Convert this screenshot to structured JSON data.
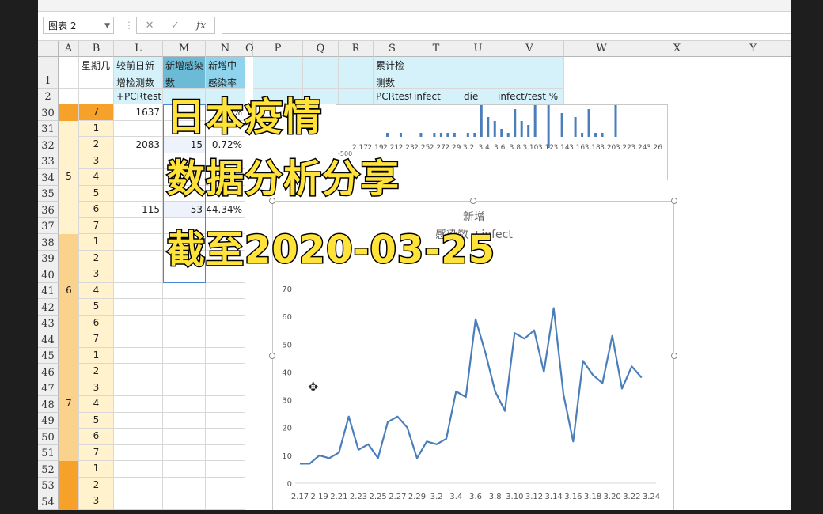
{
  "name_box": "图表 2",
  "formula_icons": {
    "cancel": "✕",
    "enter": "✓",
    "fx": "fx"
  },
  "columns": [
    "A",
    "B",
    "L",
    "M",
    "N",
    "O",
    "P",
    "Q",
    "R",
    "S",
    "T",
    "U",
    "V",
    "W",
    "X",
    "Y"
  ],
  "header_row1": {
    "B": "星期几",
    "L": "较前日新增检测数",
    "M": "新增感染数",
    "N": "新增中感染率",
    "S": "累计检测数"
  },
  "header_row2": {
    "L": "+PCRtest",
    "S": "PCRtest",
    "T": "infect",
    "U": "die",
    "V": "infect/test %"
  },
  "row_numbers": [
    "1",
    "2",
    "30",
    "31",
    "32",
    "33",
    "34",
    "35",
    "36",
    "37",
    "38",
    "39",
    "40",
    "41",
    "42",
    "43",
    "44",
    "45",
    "46",
    "47",
    "48",
    "49",
    "50",
    "51",
    "52",
    "53",
    "54"
  ],
  "weekdays": [
    "7",
    "1",
    "2",
    "3",
    "4",
    "5",
    "6",
    "7",
    "1",
    "2",
    "3",
    "4",
    "5",
    "6",
    "7",
    "1",
    "2",
    "3",
    "4",
    "5",
    "6",
    "7",
    "1",
    "2",
    "3"
  ],
  "week_labels": {
    "w5": "5",
    "w6": "6",
    "w7": "7"
  },
  "visible_values": {
    "L32": "2083",
    "M32": "15",
    "N32": "0.72%",
    "L36": "115",
    "M36": "53",
    "N36": "44.34%",
    "L30": "1637",
    "N30": "%"
  },
  "overlay": {
    "line1": "日本疫情",
    "line2": "数据分析分享",
    "line3": "截至2020-03-25"
  },
  "top_chart": {
    "ytick": "-500",
    "xlabels": [
      "2.17",
      "2.19",
      "2.21",
      "2.23",
      "2.25",
      "2.27",
      "2.29",
      "3.2",
      "3.4",
      "3.6",
      "3.8",
      "3.10",
      "3.12",
      "3.14",
      "3.16",
      "3.18",
      "3.20",
      "3.22",
      "3.24",
      "3.26"
    ]
  },
  "chart_data": {
    "type": "line",
    "title": "新增感染数 +infect",
    "x": [
      "2.17",
      "2.18",
      "2.19",
      "2.20",
      "2.21",
      "2.22",
      "2.23",
      "2.24",
      "2.25",
      "2.26",
      "2.27",
      "2.28",
      "2.29",
      "3.1",
      "3.2",
      "3.3",
      "3.4",
      "3.5",
      "3.6",
      "3.7",
      "3.8",
      "3.9",
      "3.10",
      "3.11",
      "3.12",
      "3.13",
      "3.14",
      "3.15",
      "3.16",
      "3.17",
      "3.18",
      "3.19",
      "3.20",
      "3.21",
      "3.22",
      "3.23",
      "3.24"
    ],
    "xlabels": [
      "2.17",
      "2.19",
      "2.21",
      "2.23",
      "2.25",
      "2.27",
      "2.29",
      "3.2",
      "3.4",
      "3.6",
      "3.8",
      "3.10",
      "3.12",
      "3.14",
      "3.16",
      "3.18",
      "3.20",
      "3.22",
      "3.24"
    ],
    "series": [
      {
        "name": "新增感染数 +infect",
        "values": [
          7,
          7,
          10,
          9,
          11,
          24,
          12,
          14,
          9,
          22,
          24,
          20,
          9,
          15,
          14,
          16,
          33,
          31,
          59,
          47,
          33,
          26,
          54,
          52,
          55,
          40,
          63,
          32,
          15,
          44,
          39,
          36,
          53,
          34,
          42,
          38,
          null
        ]
      }
    ],
    "yticks": [
      0,
      10,
      20,
      30,
      40,
      50,
      60,
      70
    ],
    "ylim": [
      0,
      70
    ],
    "color": "#4a7ebb",
    "grid": false
  },
  "colors": {
    "accent": "#4a7ebb",
    "overlay_text": "#ffe23a"
  }
}
